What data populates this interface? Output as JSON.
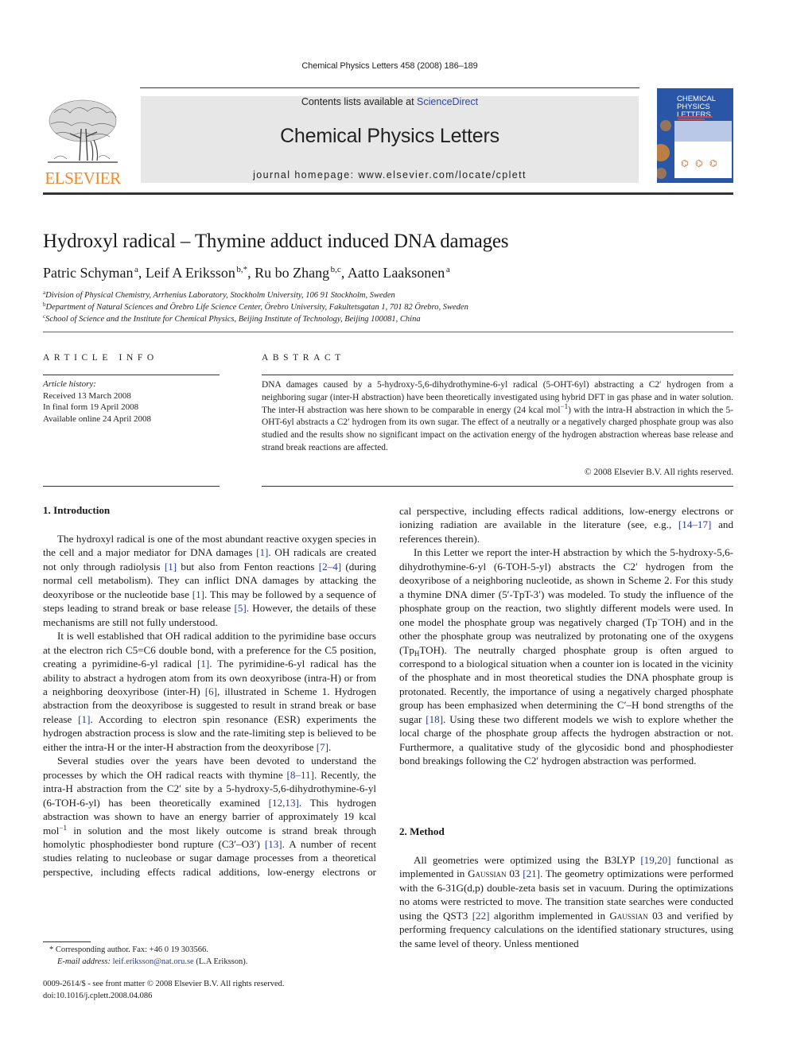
{
  "running_head": "Chemical Physics Letters 458 (2008) 186–189",
  "header": {
    "publisher_logo_text": "ELSEVIER",
    "contents_prefix": "Contents lists available at ",
    "contents_link": "ScienceDirect",
    "journal_title": "Chemical Physics Letters",
    "homepage": "journal homepage: www.elsevier.com/locate/cplett",
    "cover": {
      "line1": "CHEMICAL",
      "line2": "PHYSICS",
      "line3": "LETTERS",
      "color": "#2a56a8"
    }
  },
  "article": {
    "title": "Hydroxyl radical – Thymine adduct induced DNA damages",
    "authors": [
      {
        "name": "Patric Schyman",
        "sup": "a",
        "sep": ", "
      },
      {
        "name": "Leif A Eriksson",
        "sup": "b,*",
        "sep": ", "
      },
      {
        "name": "Ru bo Zhang",
        "sup": "b,c",
        "sep": ", "
      },
      {
        "name": "Aatto Laaksonen",
        "sup": "a",
        "sep": ""
      }
    ],
    "affiliations": [
      {
        "mark": "a",
        "text": "Division of Physical Chemistry, Arrhenius Laboratory, Stockholm University, 106 91 Stockholm, Sweden"
      },
      {
        "mark": "b",
        "text": "Department of Natural Sciences and Örebro Life Science Center, Örebro University, Fakultetsgatan 1, 701 82 Örebro, Sweden"
      },
      {
        "mark": "c",
        "text": "School of Science and the Institute for Chemical Physics, Beijing Institute of Technology, Beijing 100081, China"
      }
    ]
  },
  "article_info": {
    "heading": "ARTICLE INFO",
    "history_label": "Article history:",
    "received": "Received 13 March 2008",
    "final_form": "In final form 19 April 2008",
    "online": "Available online 24 April 2008"
  },
  "abstract": {
    "heading": "ABSTRACT",
    "text_1": "DNA damages caused by a 5-hydroxy-5,6-dihydrothymine-6-yl radical (5-OHT-6yl) abstracting a C2′ hydrogen from a neighboring sugar (inter-H abstraction) have been theoretically investigated using hybrid DFT in gas phase and in water solution. The inter-H abstraction was here shown to be comparable in energy (24 kcal mol",
    "text_sup": "−1",
    "text_2": ") with the intra-H abstraction in which the 5-OHT-6yl abstracts a C2′ hydrogen from its own sugar. The effect of a neutrally or a negatively charged phosphate group was also studied and the results show no significant impact on the activation energy of the hydrogen abstraction whereas base release and strand break reactions are affected.",
    "copyright": "© 2008 Elsevier B.V. All rights reserved."
  },
  "intro": {
    "heading": "1. Introduction",
    "p1": {
      "a": "The hydroxyl radical is one of the most abundant reactive oxygen species in the cell and a major mediator for DNA damages ",
      "r1": "[1]",
      "b": ". OH radicals are created not only through radiolysis ",
      "r2": "[1]",
      "c": " but also from Fenton reactions ",
      "r3": "[2–4]",
      "d": " (during normal cell metabolism). They can inflict DNA damages by attacking the deoxyribose or the nucleotide base ",
      "r4": "[1]",
      "e": ". This may be followed by a sequence of steps leading to strand break or base release ",
      "r5": "[5]",
      "f": ". However, the details of these mechanisms are still not fully understood."
    },
    "p2": {
      "a": "It is well established that OH radical addition to the pyrimidine base occurs at the electron rich C5=C6 double bond, with a preference for the C5 position, creating a pyrimidine-6-yl radical ",
      "r1": "[1]",
      "b": ". The pyrimidine-6-yl radical has the ability to abstract a hydrogen atom from its own deoxyribose (intra-H) or from a neighboring deoxyribose (inter-H) ",
      "r2": "[6]",
      "c": ", illustrated in Scheme 1. Hydrogen abstraction from the deoxyribose is suggested to result in strand break or base release ",
      "r3": "[1]",
      "d": ". According to electron spin resonance (ESR) experiments the hydrogen abstraction process is slow and the rate-limiting step is believed to be either the intra-H or the inter-H abstraction from the deoxyribose ",
      "r4": "[7]",
      "e": "."
    },
    "p3": {
      "a": "Several studies over the years have been devoted to understand the processes by which the OH radical reacts with thymine ",
      "r1": "[8–11]",
      "b": ". Recently, the intra-H abstraction from the C2′ site by a 5-hydroxy-5,6-dihydrothymine-6-yl (6-TOH-6-yl) has been theoretically examined ",
      "r2": "[12,13]",
      "c": ". This hydrogen abstraction was shown to have an energy barrier of approximately 19 kcal mol",
      "sup": "−1",
      "d": " in solution and the most likely outcome is strand break through homolytic phosphodiester bond rupture (C3′–O3′) ",
      "r3": "[13]",
      "e": ". A number of recent studies relating to nucleobase or sugar damage processes from a theoretical perspective, including effects radical additions, low-energy electrons or ionizing radiation are available in the literature (see, e.g., ",
      "r4": "[14–17]",
      "f": " and references therein)."
    },
    "p4": {
      "a": "In this Letter we report the inter-H abstraction by which the 5-hydroxy-5,6-dihydrothymine-6-yl (6-TOH-5-yl) abstracts the C2′ hydrogen from the deoxyribose of a neighboring nucleotide, as shown in Scheme 2. For this study a thymine DNA dimer (5′-TpT-3′) was modeled. To study the influence of the phosphate group on the reaction, two slightly different models were used. In one model the phosphate group was negatively charged (Tp",
      "sup": "−",
      "b": "TOH) and in the other the phosphate group was neutralized by protonating one of the oxygens (Tp",
      "sub": "H",
      "c": "TOH). The neutrally charged phosphate group is often argued to correspond to a biological situation when a counter ion is located in the vicinity of the phosphate and in most theoretical studies the DNA phosphate group is protonated. Recently, the importance of using a negatively charged phosphate group has been emphasized when determining the C′–H bond strengths of the sugar ",
      "r1": "[18]",
      "d": ". Using these two different models we wish to explore whether the local charge of the phosphate group affects the hydrogen abstraction or not. Furthermore, a qualitative study of the glycosidic bond and phosphodiester bond breakings following the C2′ hydrogen abstraction was performed."
    }
  },
  "method": {
    "heading": "2. Method",
    "p1": {
      "a": "All geometries were optimized using the B3LYP ",
      "r1": "[19,20]",
      "b": " functional as implemented in ",
      "sc1": "Gaussian",
      "c": " 03 ",
      "r2": "[21]",
      "d": ". The geometry optimizations were performed with the 6-31G(d,p) double-zeta basis set in vacuum. During the optimizations no atoms were restricted to move. The transition state searches were conducted using the QST3 ",
      "r3": "[22]",
      "e": " algorithm implemented in ",
      "sc2": "Gaussian",
      "f": " 03 and verified by performing frequency calculations on the identified stationary structures, using the same level of theory. Unless mentioned"
    }
  },
  "footnote": {
    "corresponding": "* Corresponding author. Fax: +46 0 19 303566.",
    "email_label": "E-mail address:",
    "email": "leif.eriksson@nat.oru.se",
    "email_suffix": " (L.A Eriksson)."
  },
  "front_matter": {
    "issn_line": "0009-2614/$ - see front matter © 2008 Elsevier B.V. All rights reserved.",
    "doi": "doi:10.1016/j.cplett.2008.04.086"
  }
}
